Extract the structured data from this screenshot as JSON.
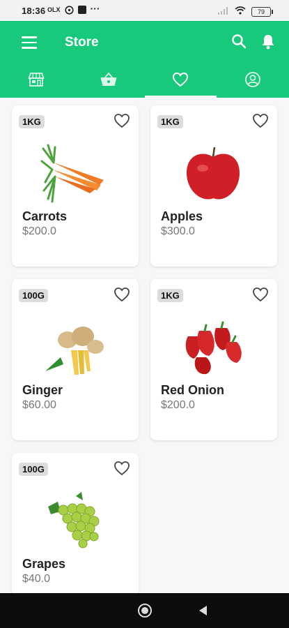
{
  "status_bar": {
    "time": "18:36",
    "battery": "79"
  },
  "app_bar": {
    "title": "Store"
  },
  "tabs": [
    {
      "icon": "store-icon"
    },
    {
      "icon": "basket-icon"
    },
    {
      "icon": "heart-icon",
      "active": true
    },
    {
      "icon": "profile-icon"
    }
  ],
  "products": [
    {
      "name": "Carrots",
      "price": "$200.0",
      "unit": "1KG",
      "image": "carrots"
    },
    {
      "name": "Apples",
      "price": "$300.0",
      "unit": "1KG",
      "image": "apple"
    },
    {
      "name": "Ginger",
      "price": "$60.00",
      "unit": "100G",
      "image": "ginger"
    },
    {
      "name": "Red Onion",
      "price": "$200.0",
      "unit": "1KG",
      "image": "red-peppers"
    },
    {
      "name": "Grapes",
      "price": "$40.0",
      "unit": "100G",
      "image": "grapes"
    }
  ],
  "colors": {
    "primary": "#19c97b",
    "card": "#ffffff",
    "background": "#f7f7f7"
  }
}
